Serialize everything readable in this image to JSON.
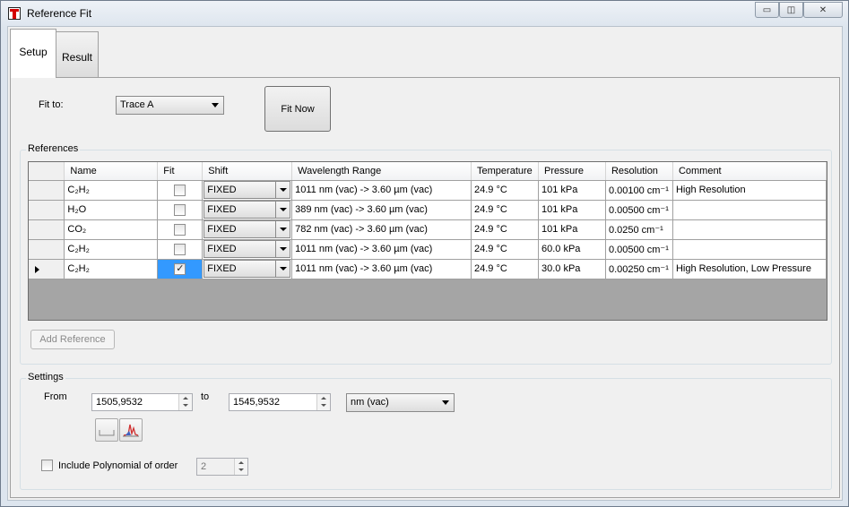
{
  "window": {
    "title": "Reference Fit",
    "minimize_glyph": "▭",
    "restore_glyph": "◫",
    "close_glyph": "✕"
  },
  "tabs": [
    {
      "label": "Setup",
      "active": true
    },
    {
      "label": "Result",
      "active": false
    }
  ],
  "fit": {
    "label": "Fit to:",
    "selected": "Trace A",
    "fit_now_label": "Fit Now"
  },
  "references": {
    "group_title": "References",
    "columns": [
      "Name",
      "Fit",
      "Shift",
      "Wavelength Range",
      "Temperature",
      "Pressure",
      "Resolution",
      "Comment"
    ],
    "rows": [
      {
        "name": "C₂H₂",
        "fit": false,
        "shift": "FIXED",
        "range": "1011 nm (vac) -> 3.60 µm (vac)",
        "temperature": "24.9 °C",
        "pressure": "101 kPa",
        "resolution": "0.00100 cm⁻¹",
        "comment": "High Resolution",
        "current": false
      },
      {
        "name": "H₂O",
        "fit": false,
        "shift": "FIXED",
        "range": "389 nm (vac) -> 3.60 µm (vac)",
        "temperature": "24.9 °C",
        "pressure": "101 kPa",
        "resolution": "0.00500 cm⁻¹",
        "comment": "",
        "current": false
      },
      {
        "name": "CO₂",
        "fit": false,
        "shift": "FIXED",
        "range": "782 nm (vac) -> 3.60 µm (vac)",
        "temperature": "24.9 °C",
        "pressure": "101 kPa",
        "resolution": "0.0250 cm⁻¹",
        "comment": "",
        "current": false
      },
      {
        "name": "C₂H₂",
        "fit": false,
        "shift": "FIXED",
        "range": "1011 nm (vac) -> 3.60 µm (vac)",
        "temperature": "24.9 °C",
        "pressure": "60.0 kPa",
        "resolution": "0.00500 cm⁻¹",
        "comment": "",
        "current": false
      },
      {
        "name": "C₂H₂",
        "fit": true,
        "shift": "FIXED",
        "range": "1011 nm (vac) -> 3.60 µm (vac)",
        "temperature": "24.9 °C",
        "pressure": "30.0 kPa",
        "resolution": "0.00250 cm⁻¹",
        "comment": "High Resolution, Low Pressure",
        "current": true
      }
    ],
    "add_reference_label": "Add Reference"
  },
  "settings": {
    "group_title": "Settings",
    "from_label": "From",
    "from_value": "1505,9532",
    "to_label": "to",
    "to_value": "1545,9532",
    "unit": "nm (vac)",
    "include_polynomial_label": "Include Polynomial of order",
    "include_polynomial_checked": false,
    "polynomial_order": "2"
  },
  "colors": {
    "selection": "#3399ff",
    "grid_empty": "#a5a5a5"
  }
}
